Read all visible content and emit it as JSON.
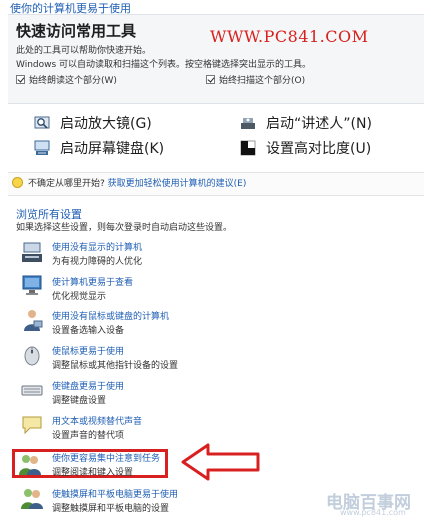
{
  "page": {
    "title": "使你的计算机更易于使用"
  },
  "quick_access": {
    "title": "快速访问常用工具",
    "watermark_url": "WWW.PC841.COM",
    "desc1": "此处的工具可以帮助你快速开始。",
    "desc2": "Windows 可以自动读取和扫描这个列表。按空格键选择突出显示的工具。",
    "checkbox_read": "始终朗读这个部分(W)",
    "checkbox_scan": "始终扫描这个部分(O)",
    "links": [
      {
        "label": "启动放大镜(G)",
        "icon": "magnifier-icon"
      },
      {
        "label": "启动“讲述人”(N)",
        "icon": "narrator-icon"
      },
      {
        "label": "启动屏幕键盘(K)",
        "icon": "keyboard-icon"
      },
      {
        "label": "设置高对比度(U)",
        "icon": "contrast-icon"
      }
    ]
  },
  "hint": {
    "prefix": "不确定从哪里开始?",
    "link": "获取更加轻松使用计算机的建议(E)"
  },
  "browse": {
    "title": "浏览所有设置",
    "subtitle": "如果选择这些设置，则每次登录时自动启动这些设置。",
    "items": [
      {
        "link": "使用没有显示的计算机",
        "desc": "为有视力障碍的人优化",
        "icon": "screen-reader-icon"
      },
      {
        "link": "使计算机更易于查看",
        "desc": "优化视觉显示",
        "icon": "monitor-icon"
      },
      {
        "link": "使用没有鼠标或键盘的计算机",
        "desc": "设置备选输入设备",
        "icon": "user-input-icon"
      },
      {
        "link": "使鼠标更易于使用",
        "desc": "调整鼠标或其他指针设备的设置",
        "icon": "mouse-icon"
      },
      {
        "link": "使键盘更易于使用",
        "desc": "调整键盘设置",
        "icon": "keyboard-device-icon"
      },
      {
        "link": "用文本或视频替代声音",
        "desc": "设置声音的替代项",
        "icon": "speech-bubble-icon"
      },
      {
        "link": "使你更容易集中注意到任务",
        "desc": "调整阅读和键入设置",
        "icon": "users-focus-icon"
      },
      {
        "link": "使触摸屏和平板电脑更易于使用",
        "desc": "调整触摸屏和平板电脑的设置",
        "icon": "touch-users-icon"
      }
    ]
  },
  "watermark": {
    "brand": "电脑百事网",
    "url": "www.pc841.com"
  },
  "colors": {
    "link": "#1f5fb4",
    "highlight": "#d92020"
  }
}
